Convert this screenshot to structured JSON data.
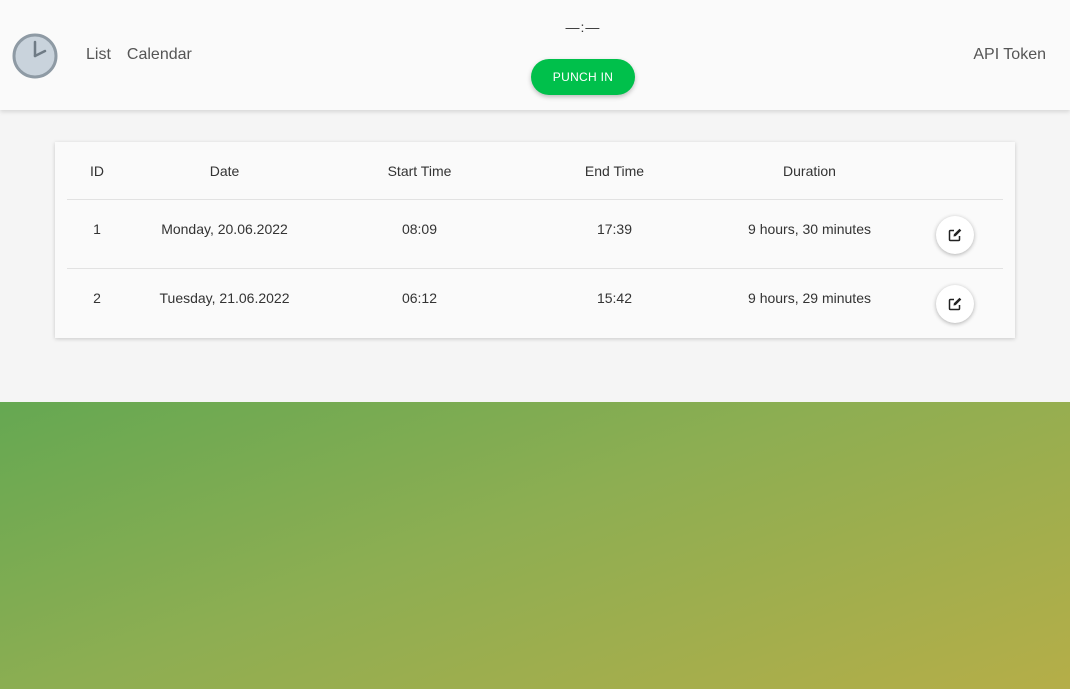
{
  "app": {
    "logo_icon": "clock-icon"
  },
  "nav": {
    "list_label": "List",
    "calendar_label": "Calendar",
    "api_token_label": "API Token"
  },
  "timer": {
    "display": "—:—",
    "punch_label": "PUNCH IN",
    "punch_color": "#00c04b"
  },
  "table": {
    "headers": {
      "id": "ID",
      "date": "Date",
      "start": "Start Time",
      "end": "End Time",
      "duration": "Duration"
    },
    "rows": [
      {
        "id": "1",
        "date": "Monday, 20.06.2022",
        "start": "08:09",
        "end": "17:39",
        "duration": "9 hours, 30 minutes",
        "action_icon": "edit-icon"
      },
      {
        "id": "2",
        "date": "Tuesday, 21.06.2022",
        "start": "06:12",
        "end": "15:42",
        "duration": "9 hours, 29 minutes",
        "action_icon": "edit-icon"
      }
    ]
  },
  "footer": {
    "gradient_start": "#65a852",
    "gradient_end": "#b5ae48"
  }
}
